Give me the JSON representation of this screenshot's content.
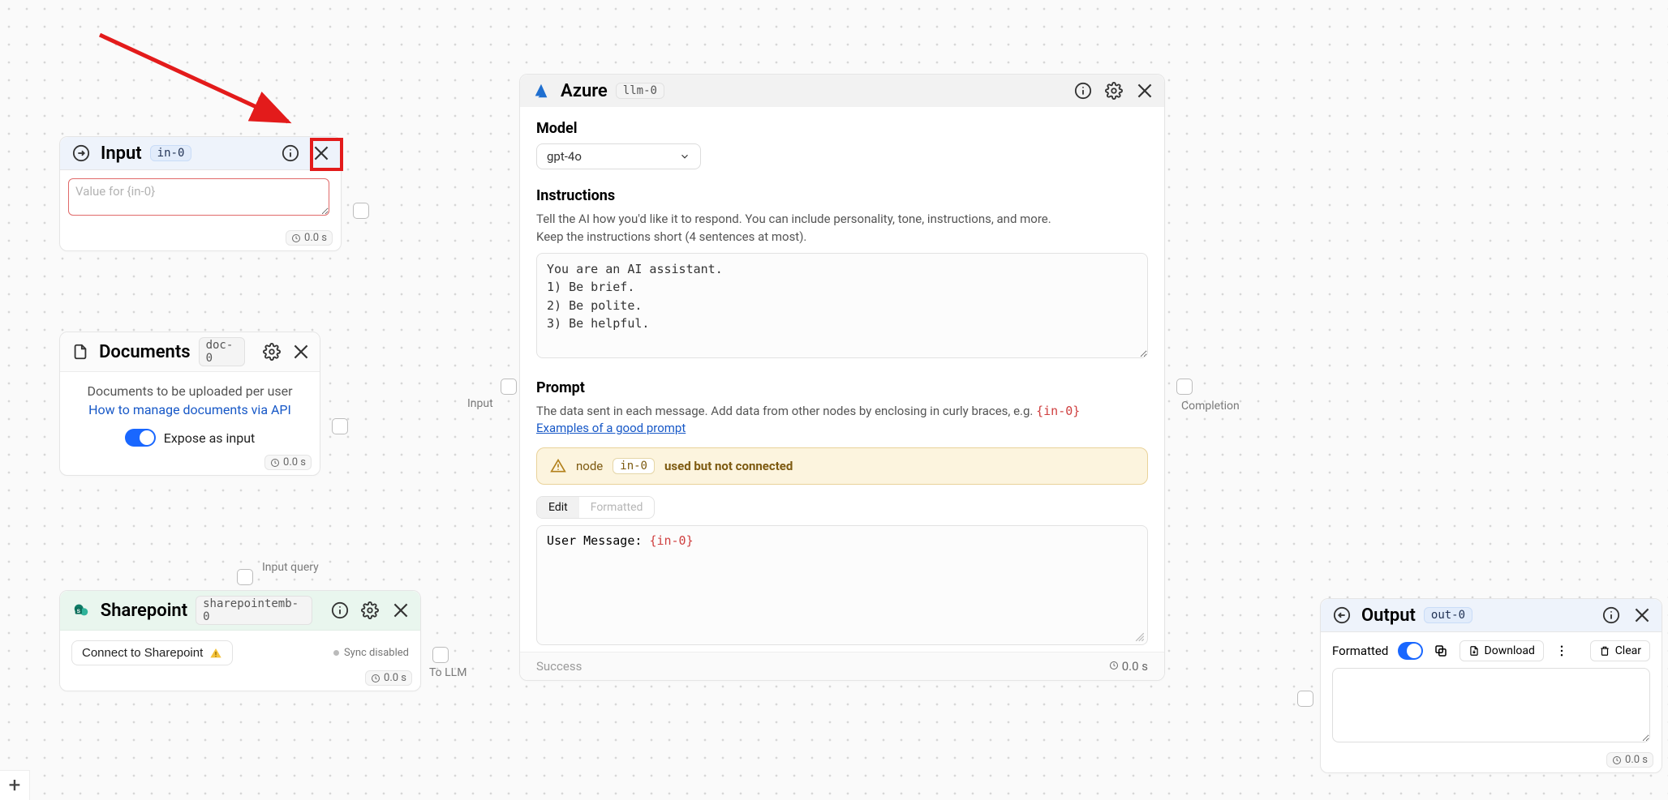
{
  "annotation_arrow": {
    "highlight_target": "input-node-close-icon"
  },
  "input_node": {
    "title": "Input",
    "id": "in-0",
    "placeholder": "Value for {in-0}",
    "time": "0.0 s"
  },
  "documents_node": {
    "title": "Documents",
    "id": "doc-0",
    "desc": "Documents to be uploaded per user",
    "link_text": "How to manage documents via API",
    "toggle_label": "Expose as input",
    "toggle_on": true,
    "time": "0.0 s"
  },
  "sharepoint_node": {
    "title": "Sharepoint",
    "id": "sharepointemb-0",
    "button_label": "Connect to Sharepoint",
    "status": "Sync disabled",
    "time": "0.0 s",
    "port_in_label": "Input query",
    "port_out_label": "To LLM"
  },
  "azure_node": {
    "title": "Azure",
    "id": "llm-0",
    "sections": {
      "model": {
        "heading": "Model",
        "selected": "gpt-4o"
      },
      "instructions": {
        "heading": "Instructions",
        "hint_line1": "Tell the AI how you'd like it to respond. You can include personality, tone, instructions, and more.",
        "hint_line2": "Keep the instructions short (4 sentences at most).",
        "value": "You are an AI assistant.\n1) Be brief.\n2) Be polite.\n3) Be helpful."
      },
      "prompt": {
        "heading": "Prompt",
        "hint_prefix": "The data sent in each message. Add data from other nodes by enclosing in curly braces, e.g. ",
        "hint_example": "{in-0}",
        "examples_link": "Examples of a good prompt",
        "tabs": {
          "edit": "Edit",
          "formatted": "Formatted",
          "active": "Edit"
        },
        "value_prefix": "User Message: ",
        "value_var": "{in-0}"
      }
    },
    "warning": {
      "prefix": "node",
      "ref": "in-0",
      "suffix": "used but not connected"
    },
    "footer_status": "Success",
    "time": "0.0 s",
    "ports": {
      "in_label": "Input",
      "out_label": "Completion"
    }
  },
  "output_node": {
    "title": "Output",
    "id": "out-0",
    "toolbar": {
      "formatted_label": "Formatted",
      "formatted_on": true,
      "download": "Download",
      "clear": "Clear"
    },
    "time": "0.0 s"
  },
  "canvas": {
    "add_label": "+"
  }
}
